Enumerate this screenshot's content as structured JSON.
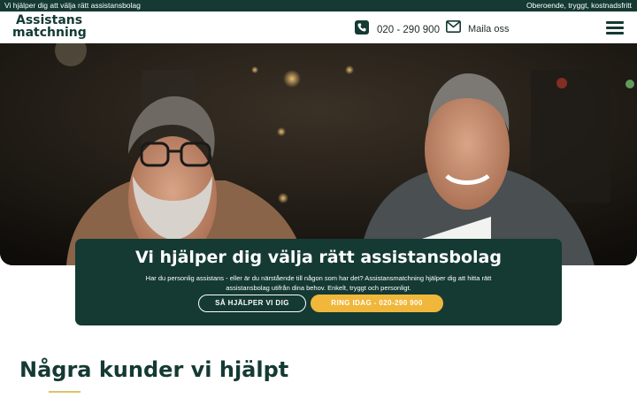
{
  "topbar": {
    "left_text": "Vi hjälper dig att välja rätt assistansbolag",
    "right_text": "Oberoende, tryggt, kostnadsfritt"
  },
  "header": {
    "logo_line1": "Assistans",
    "logo_line2": "matchning",
    "phone_icon": "phone-icon",
    "phone_number": "020 - 290 900",
    "mail_icon": "mail-icon",
    "mail_label": "Maila oss",
    "menu_icon": "hamburger-menu-icon"
  },
  "hero": {
    "image_description": "photo-two-men-smiling",
    "title": "Vi hjälper dig välja rätt assistansbolag",
    "body": "Har du personlig assistans - eller är du närstående till någon som har det? Assistansmatchning hjälper dig att hitta rätt assistansbolag utifrån dina behov. Enkelt, tryggt och personligt.",
    "button_secondary": "SÅ HJÄLPER VI DIG",
    "button_primary": "RING IDAG - 020-290 900"
  },
  "section": {
    "title": "Några kunder vi hjälpt"
  },
  "colors": {
    "brand_dark": "#143a33",
    "accent_yellow": "#f0b73b",
    "underline_gold": "#e0c26a"
  }
}
